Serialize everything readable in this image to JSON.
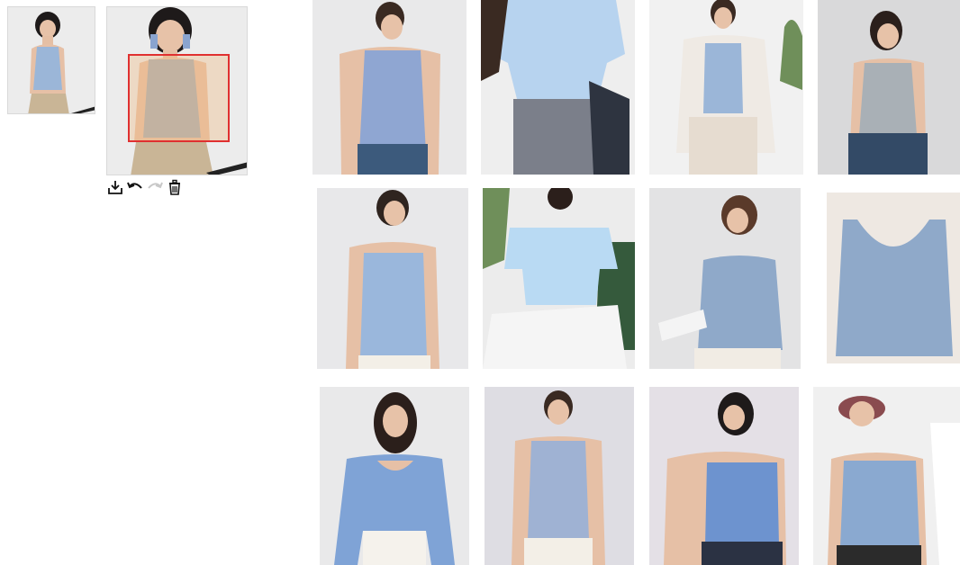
{
  "query": {
    "thumbnail": {
      "icon": "query-photo-thumbnail"
    },
    "crop_editor": {
      "icon": "cropped-query-photo",
      "selection": "selected-region"
    }
  },
  "toolbar": {
    "items": [
      {
        "name": "download-icon",
        "enabled": true
      },
      {
        "name": "undo-icon",
        "enabled": true
      },
      {
        "name": "redo-icon",
        "enabled": false
      },
      {
        "name": "trash-icon",
        "enabled": true
      }
    ]
  },
  "colors": {
    "selection": "#e03030",
    "garment_blue": "#9bb6d8",
    "garment_sky": "#b7d3ef",
    "garment_grey": "#a9b0b6",
    "garment_royal": "#7ea1d4"
  },
  "results": [
    {
      "name": "result-square-neck-tank"
    },
    {
      "name": "result-light-blue-tee"
    },
    {
      "name": "result-ribbed-tank-with-cardigan"
    },
    {
      "name": "result-grey-halter-tank"
    },
    {
      "name": "result-blue-cami-top"
    },
    {
      "name": "result-off-shoulder-tee"
    },
    {
      "name": "result-blue-knit-cardigan"
    },
    {
      "name": "result-v-neck-crop-tank"
    },
    {
      "name": "result-blue-long-sleeve-crop"
    },
    {
      "name": "result-blue-square-neck-tank"
    },
    {
      "name": "result-royal-blue-cami"
    },
    {
      "name": "result-blue-tank-bucket-hat"
    }
  ]
}
